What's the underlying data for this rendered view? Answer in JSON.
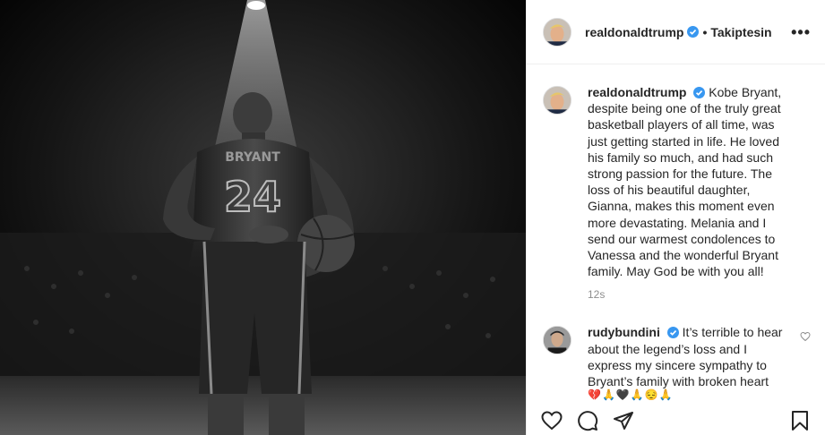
{
  "post": {
    "image_alt": "Kobe Bryant photo",
    "jersey_name": "BRYANT",
    "jersey_number": "24"
  },
  "header": {
    "username": "realdonaldtrump",
    "separator": "•",
    "follow_state": "Takiptesin"
  },
  "caption": {
    "username": "realdonaldtrump",
    "text": "Kobe Bryant, despite being one of the truly great basketball players of all time, was just getting started in life. He loved his family so much, and had such strong passion for the future. The loss of his beautiful daughter, Gianna, makes this moment even more devastating. Melania and I send our warmest condolences to Vanessa and the wonderful Bryant family. May God be with you all!",
    "timestamp": "12s"
  },
  "reply": {
    "username": "rudybundini",
    "text": "It’s terrible to hear about the legend’s loss and I express my sincere sympathy to Bryant’s family with broken heart",
    "emojis": "💔🙏🖤🙏😔🙏"
  },
  "icons": {
    "verified": "verified-badge-icon",
    "more": "more-options-icon",
    "like": "heart-icon",
    "comment": "comment-icon",
    "share": "share-icon",
    "save": "bookmark-icon",
    "comment_like": "heart-icon"
  },
  "colors": {
    "verified_blue": "#3897f0",
    "text": "#262626",
    "muted": "#8e8e8e",
    "border": "#efefef"
  }
}
